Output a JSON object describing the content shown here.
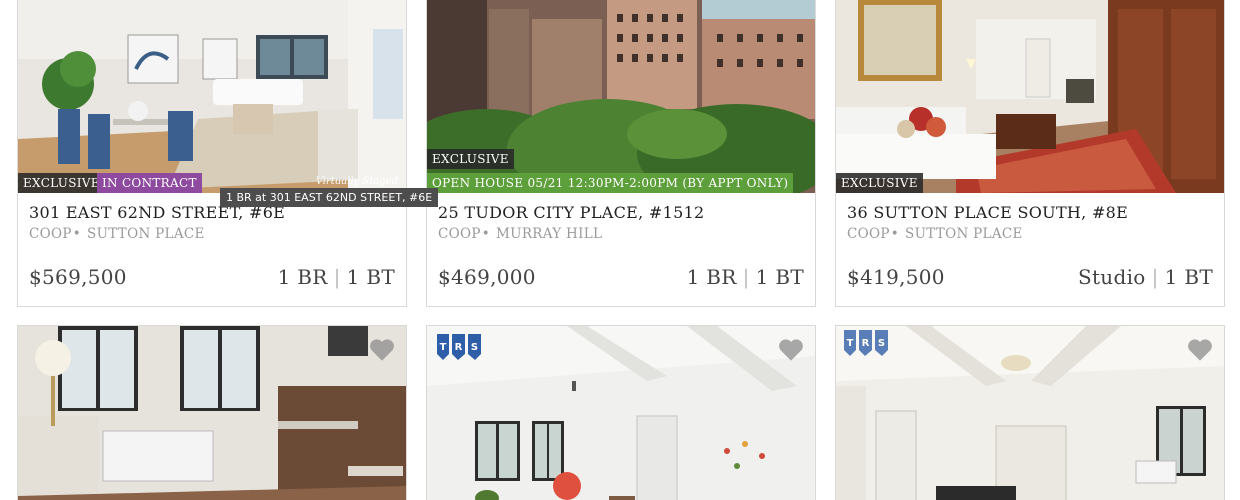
{
  "listings": [
    {
      "address": "301 EAST 62ND STREET, #6E",
      "type": "COOP",
      "neighborhood": "SUTTON PLACE",
      "price": "$569,500",
      "bedrooms": "1 BR",
      "baths": "1 BT",
      "badges": [
        "EXCLUSIVE",
        "IN CONTRACT"
      ],
      "watermark": "Virtually Staged",
      "tooltip": "1 BR at 301 EAST 62ND STREET, #6E"
    },
    {
      "address": "25 TUDOR CITY PLACE, #1512",
      "type": "COOP",
      "neighborhood": "MURRAY HILL",
      "price": "$469,000",
      "bedrooms": "1 BR",
      "baths": "1 BT",
      "badges": [
        "EXCLUSIVE",
        "OPEN HOUSE 05/21 12:30PM-2:00PM (BY APPT ONLY)"
      ]
    },
    {
      "address": "36 SUTTON PLACE SOUTH, #8E",
      "type": "COOP",
      "neighborhood": "SUTTON PLACE",
      "price": "$419,500",
      "bedrooms": "Studio",
      "baths": "1 BT",
      "badges": [
        "EXCLUSIVE"
      ]
    }
  ],
  "bottom_row": [
    {
      "logo_text": ""
    },
    {
      "logo_text": "TRS"
    },
    {
      "logo_text": "TRS"
    }
  ],
  "colors": {
    "exclusive_badge": "#282828",
    "contract_badge": "#8e4a9e",
    "open_house_badge": "#5d9f3b"
  }
}
